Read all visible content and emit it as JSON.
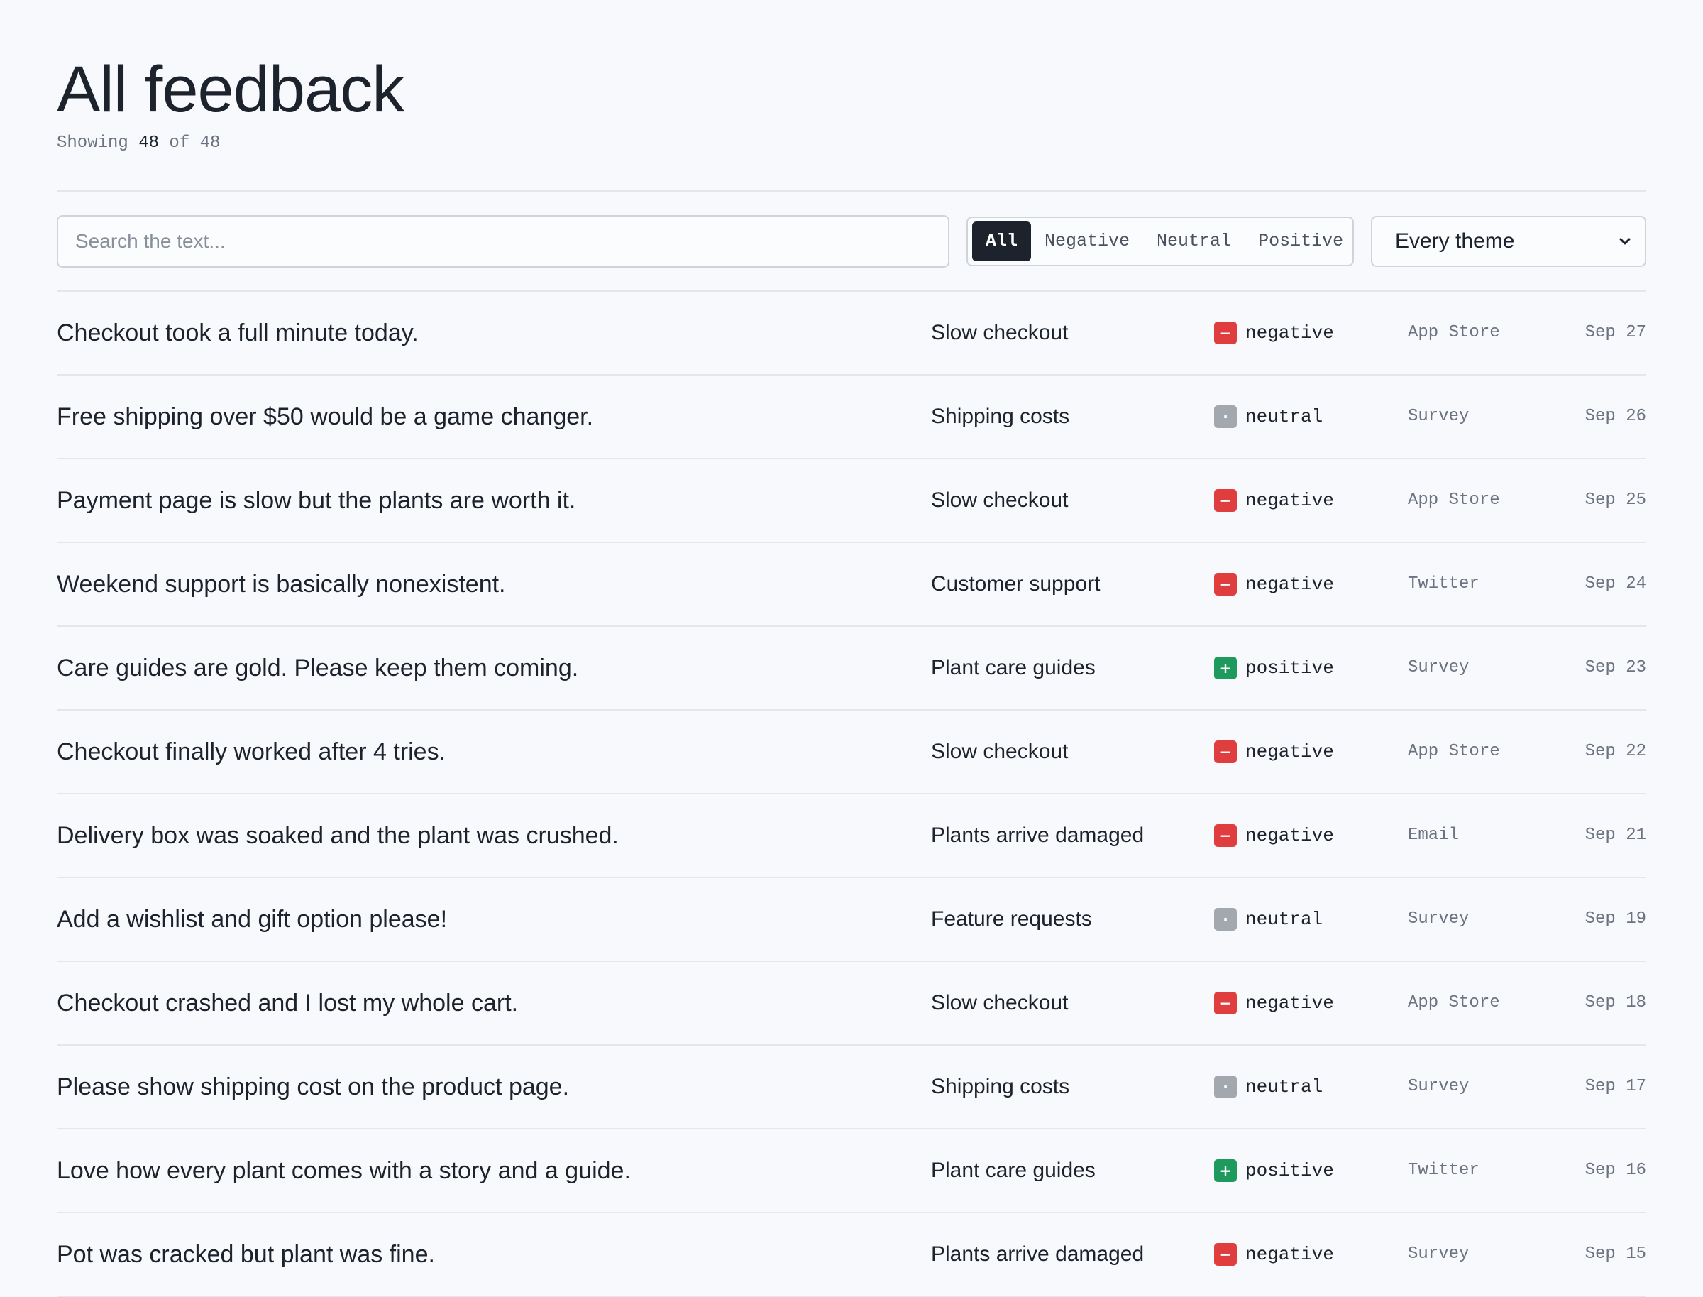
{
  "header": {
    "title": "All feedback",
    "count_prefix": "Showing ",
    "count_shown": "48",
    "count_mid": " of ",
    "count_total": "48"
  },
  "filters": {
    "search_placeholder": "Search the text...",
    "sentiment_options": [
      "All",
      "Negative",
      "Neutral",
      "Positive"
    ],
    "sentiment_selected": "All",
    "theme_selected": "Every theme"
  },
  "colors": {
    "negative": "#e03e3e",
    "neutral": "#a3a7ae",
    "positive": "#1f9a5e"
  },
  "badge_glyphs": {
    "negative": "−",
    "neutral": "·",
    "positive": "+"
  },
  "rows": [
    {
      "text": "Checkout took a full minute today.",
      "theme": "Slow checkout",
      "sentiment": "negative",
      "source": "App Store",
      "date": "Sep 27"
    },
    {
      "text": "Free shipping over $50 would be a game changer.",
      "theme": "Shipping costs",
      "sentiment": "neutral",
      "source": "Survey",
      "date": "Sep 26"
    },
    {
      "text": "Payment page is slow but the plants are worth it.",
      "theme": "Slow checkout",
      "sentiment": "negative",
      "source": "App Store",
      "date": "Sep 25"
    },
    {
      "text": "Weekend support is basically nonexistent.",
      "theme": "Customer support",
      "sentiment": "negative",
      "source": "Twitter",
      "date": "Sep 24"
    },
    {
      "text": "Care guides are gold. Please keep them coming.",
      "theme": "Plant care guides",
      "sentiment": "positive",
      "source": "Survey",
      "date": "Sep 23"
    },
    {
      "text": "Checkout finally worked after 4 tries.",
      "theme": "Slow checkout",
      "sentiment": "negative",
      "source": "App Store",
      "date": "Sep 22"
    },
    {
      "text": "Delivery box was soaked and the plant was crushed.",
      "theme": "Plants arrive damaged",
      "sentiment": "negative",
      "source": "Email",
      "date": "Sep 21"
    },
    {
      "text": "Add a wishlist and gift option please!",
      "theme": "Feature requests",
      "sentiment": "neutral",
      "source": "Survey",
      "date": "Sep 19"
    },
    {
      "text": "Checkout crashed and I lost my whole cart.",
      "theme": "Slow checkout",
      "sentiment": "negative",
      "source": "App Store",
      "date": "Sep 18"
    },
    {
      "text": "Please show shipping cost on the product page.",
      "theme": "Shipping costs",
      "sentiment": "neutral",
      "source": "Survey",
      "date": "Sep 17"
    },
    {
      "text": "Love how every plant comes with a story and a guide.",
      "theme": "Plant care guides",
      "sentiment": "positive",
      "source": "Twitter",
      "date": "Sep 16"
    },
    {
      "text": "Pot was cracked but plant was fine.",
      "theme": "Plants arrive damaged",
      "sentiment": "negative",
      "source": "Survey",
      "date": "Sep 15"
    }
  ]
}
